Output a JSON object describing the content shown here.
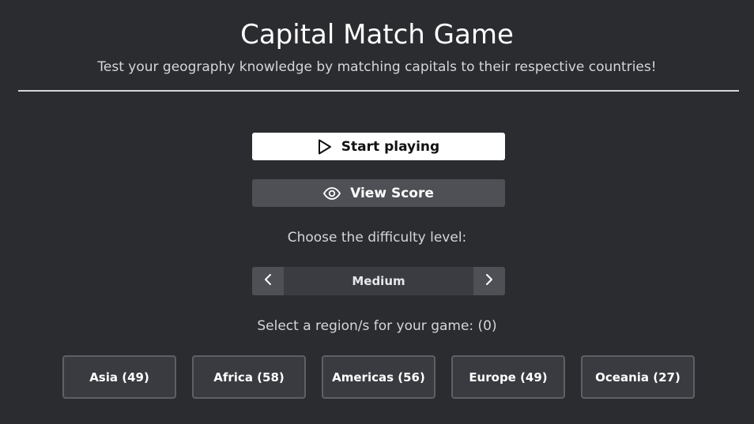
{
  "header": {
    "title": "Capital Match Game",
    "subtitle": "Test your geography knowledge by matching capitals to their respective countries!"
  },
  "actions": {
    "start_label": "Start playing",
    "start_icon": "play-icon",
    "score_label": "View Score",
    "score_icon": "eye-icon"
  },
  "difficulty": {
    "prompt": "Choose the difficulty level:",
    "value": "Medium",
    "prev_icon": "chevron-left-icon",
    "next_icon": "chevron-right-icon"
  },
  "regions": {
    "prompt": "Select a region/s for your game: (0)",
    "items": [
      {
        "label": "Asia (49)"
      },
      {
        "label": "Africa (58)"
      },
      {
        "label": "Americas (56)"
      },
      {
        "label": "Europe (49)"
      },
      {
        "label": "Oceania (27)"
      }
    ]
  },
  "colors": {
    "background": "#2b2c30",
    "primary_button": "#ffffff",
    "secondary_button": "#4f5055",
    "region_border": "#5f6066"
  }
}
